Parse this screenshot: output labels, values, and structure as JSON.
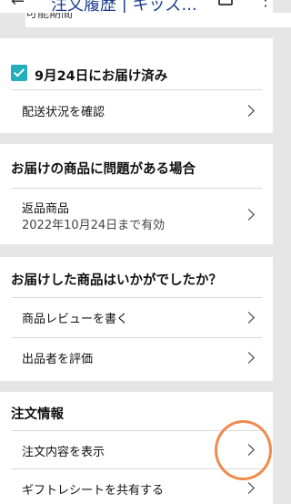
{
  "header": {
    "back_icon": "back-arrow-icon",
    "title": "注文履歴 | キッズ...",
    "print_icon": "printer-icon",
    "more_icon": "more-vertical-icon"
  },
  "top_partial_text": "可能期間",
  "delivery": {
    "status_text": "9月24日にお届け済み",
    "track_label": "配送状況を確認"
  },
  "problem": {
    "heading": "お届けの商品に問題がある場合",
    "return_label": "返品商品",
    "return_deadline": "2022年10月24日まで有効"
  },
  "feedback": {
    "heading": "お届けした商品はいかがでしたか？",
    "review_label": "商品レビューを書く",
    "seller_label": "出品者を評価"
  },
  "order_info": {
    "heading": "注文情報",
    "view_details_label": "注文内容を表示",
    "gift_receipt_label": "ギフトレシートを共有する"
  },
  "colors": {
    "check": "#22aebc",
    "highlight": "#f18a4a",
    "title": "#1a3d8f"
  }
}
